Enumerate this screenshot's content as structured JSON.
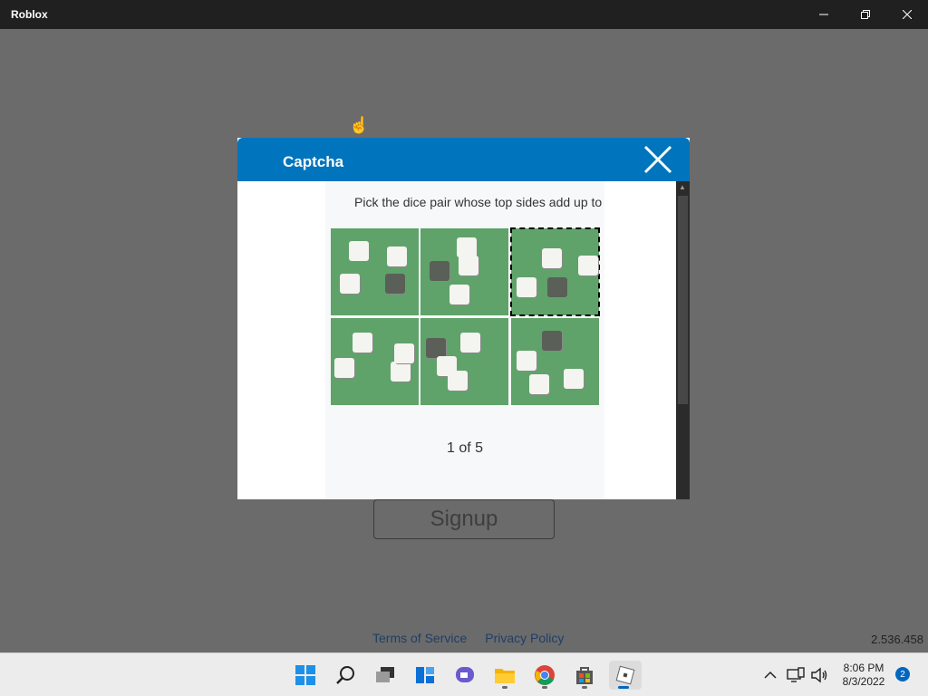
{
  "window": {
    "title": "Roblox"
  },
  "captcha": {
    "title": "Captcha",
    "instruction": "Pick the dice pair whose top sides add up to",
    "pager": "1 of 5",
    "selected_tile": 3
  },
  "page": {
    "signup_label": "Signup",
    "terms_label": "Terms of Service",
    "privacy_label": "Privacy Policy",
    "version": "2.536.458"
  },
  "taskbar": {
    "apps": [
      "start-icon",
      "search-icon",
      "task-view-icon",
      "widgets-icon",
      "teams-chat-icon",
      "file-explorer-icon",
      "chrome-icon",
      "store-icon",
      "roblox-icon"
    ],
    "time": "8:06 PM",
    "date": "8/3/2022",
    "notification_count": "2"
  },
  "colors": {
    "header": "#0074bd",
    "background": "#6b6b6b",
    "taskbar": "#ececec"
  }
}
